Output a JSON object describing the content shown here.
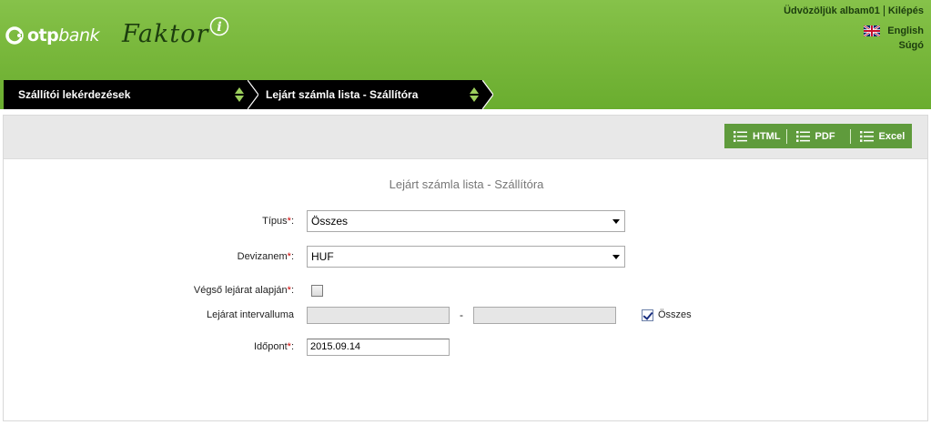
{
  "header": {
    "bank_logo": {
      "main": "otp",
      "suffix": "bank"
    },
    "app_name": "Faktor",
    "app_info_glyph": "i",
    "welcome": "Üdvözöljük albam01",
    "logout": "Kilépés",
    "language": "English",
    "help": "Súgó",
    "colors": {
      "header_green": "#79b83c",
      "dark_text": "#1c3d0e"
    }
  },
  "tabs": [
    {
      "label": "Szállítói lekérdezések"
    },
    {
      "label": "Lejárt számla lista - Szállítóra"
    }
  ],
  "toolbar": {
    "export_buttons": [
      {
        "label": "HTML",
        "icon": "list-icon"
      },
      {
        "label": "PDF",
        "icon": "list-icon"
      },
      {
        "label": "Excel",
        "icon": "list-icon"
      }
    ],
    "accent": "#5f9b3c"
  },
  "form": {
    "title": "Lejárt számla lista - Szállítóra",
    "required_mark": "*",
    "type": {
      "label": "Típus",
      "value": "Összes"
    },
    "currency": {
      "label": "Devizanem",
      "value": "HUF"
    },
    "final_due": {
      "label": "Végső lejárat alapján",
      "checked": false
    },
    "due_interval": {
      "label": "Lejárat intervalluma",
      "from": "",
      "to": "",
      "separator": "-",
      "all_label": "Összes",
      "all_checked": true
    },
    "date": {
      "label": "Időpont",
      "value": "2015.09.14"
    }
  }
}
